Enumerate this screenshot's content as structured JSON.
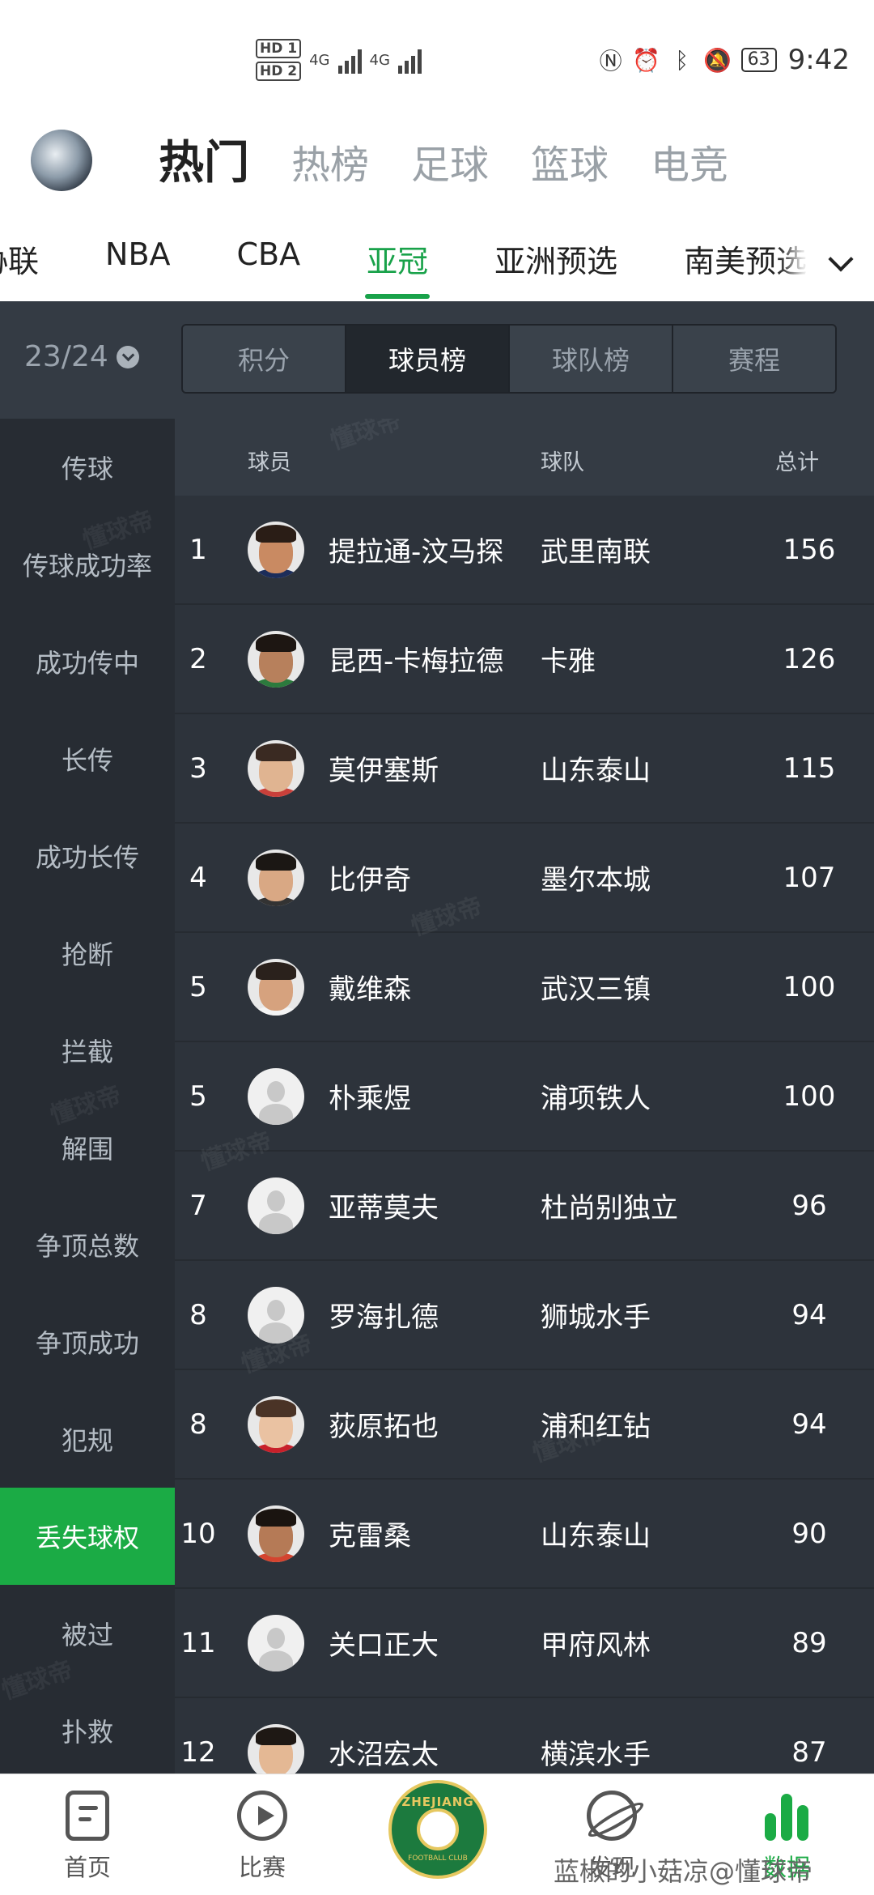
{
  "status_bar": {
    "hd1": "HD 1",
    "hd2": "HD 2",
    "net1": "4G",
    "net2": "4G",
    "battery": "63",
    "time": "9:42"
  },
  "top_nav": {
    "tabs": [
      {
        "label": "热门",
        "active": true
      },
      {
        "label": "热榜",
        "active": false
      },
      {
        "label": "足球",
        "active": false
      },
      {
        "label": "篮球",
        "active": false
      },
      {
        "label": "电竞",
        "active": false
      }
    ]
  },
  "sub_tabs": [
    {
      "label": "协联",
      "active": false
    },
    {
      "label": "NBA",
      "active": false
    },
    {
      "label": "CBA",
      "active": false
    },
    {
      "label": "亚冠",
      "active": true
    },
    {
      "label": "亚洲预选",
      "active": false
    },
    {
      "label": "南美预选",
      "active": false
    }
  ],
  "season": {
    "label": "23/24"
  },
  "segments": [
    {
      "label": "积分",
      "active": false
    },
    {
      "label": "球员榜",
      "active": true
    },
    {
      "label": "球队榜",
      "active": false
    },
    {
      "label": "赛程",
      "active": false
    }
  ],
  "sidebar": {
    "items": [
      {
        "label": "传球",
        "active": false
      },
      {
        "label": "传球成功率",
        "active": false
      },
      {
        "label": "成功传中",
        "active": false
      },
      {
        "label": "长传",
        "active": false
      },
      {
        "label": "成功长传",
        "active": false
      },
      {
        "label": "抢断",
        "active": false
      },
      {
        "label": "拦截",
        "active": false
      },
      {
        "label": "解围",
        "active": false
      },
      {
        "label": "争顶总数",
        "active": false
      },
      {
        "label": "争顶成功",
        "active": false
      },
      {
        "label": "犯规",
        "active": false
      },
      {
        "label": "丢失球权",
        "active": true
      },
      {
        "label": "被过",
        "active": false
      },
      {
        "label": "扑救",
        "active": false
      }
    ]
  },
  "table": {
    "headers": {
      "player": "球员",
      "team": "球队",
      "total": "总计"
    },
    "rows": [
      {
        "rank": "1",
        "player": "提拉通-汶马探",
        "team": "武里南联",
        "total": "156",
        "photo": "face",
        "skin": "#c98a62",
        "hair": "#2a1d16",
        "shirt": "#1c2d5a"
      },
      {
        "rank": "2",
        "player": "昆西-卡梅拉德",
        "team": "卡雅",
        "total": "126",
        "photo": "face",
        "skin": "#b7805c",
        "hair": "#1d1612",
        "shirt": "#2c7a3d"
      },
      {
        "rank": "3",
        "player": "莫伊塞斯",
        "team": "山东泰山",
        "total": "115",
        "photo": "face",
        "skin": "#e0b491",
        "hair": "#3a2a22",
        "shirt": "#c9403a"
      },
      {
        "rank": "4",
        "player": "比伊奇",
        "team": "墨尔本城",
        "total": "107",
        "photo": "face",
        "skin": "#d9a884",
        "hair": "#1b1714",
        "shirt": "#333"
      },
      {
        "rank": "5",
        "player": "戴维森",
        "team": "武汉三镇",
        "total": "100",
        "photo": "face",
        "skin": "#d6a27e",
        "hair": "#2a211c",
        "shirt": "#f4f4f4"
      },
      {
        "rank": "5",
        "player": "朴乘煜",
        "team": "浦项铁人",
        "total": "100",
        "photo": "placeholder"
      },
      {
        "rank": "7",
        "player": "亚蒂莫夫",
        "team": "杜尚别独立",
        "total": "96",
        "photo": "placeholder"
      },
      {
        "rank": "8",
        "player": "罗海扎德",
        "team": "狮城水手",
        "total": "94",
        "photo": "placeholder"
      },
      {
        "rank": "8",
        "player": "荻原拓也",
        "team": "浦和红钻",
        "total": "94",
        "photo": "face",
        "skin": "#eac2a2",
        "hair": "#4a3326",
        "shirt": "#c8202a"
      },
      {
        "rank": "10",
        "player": "克雷桑",
        "team": "山东泰山",
        "total": "90",
        "photo": "face",
        "skin": "#b57a56",
        "hair": "#1a1410",
        "shirt": "#d4442f"
      },
      {
        "rank": "11",
        "player": "关口正大",
        "team": "甲府风林",
        "total": "89",
        "photo": "placeholder"
      },
      {
        "rank": "12",
        "player": "水沼宏太",
        "team": "横滨水手",
        "total": "87",
        "photo": "face",
        "skin": "#e4b894",
        "hair": "#1e1814",
        "shirt": "#f4f4f4"
      }
    ]
  },
  "watermark": "懂球帝",
  "bottom_nav": {
    "items": [
      {
        "label": "首页",
        "icon": "home-icon"
      },
      {
        "label": "比赛",
        "icon": "match-icon"
      },
      {
        "label": "发现",
        "icon": "discover-icon"
      },
      {
        "label": "数据",
        "icon": "data-icon",
        "active": true
      }
    ],
    "logo": {
      "top": "ZHEJIANG",
      "bottom": "FOOTBALL CLUB"
    }
  },
  "credit": "蓝椒的小菇凉@懂球帝",
  "colors": {
    "accent": "#1bab45",
    "panel": "#2d333b",
    "sidebar": "#272c33"
  }
}
